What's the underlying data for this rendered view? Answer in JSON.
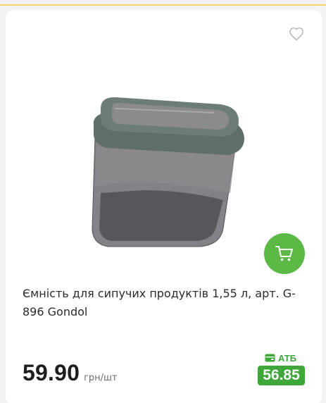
{
  "product": {
    "title": "Ємність для сипучих продуктів 1,55 л, арт. G-896 Gondol",
    "image_alt": "product-container-image"
  },
  "price": {
    "value": "59.90",
    "unit": "грн/шт"
  },
  "loyalty": {
    "label": "АТБ",
    "price": "56.85"
  },
  "icons": {
    "favorite": "heart-icon",
    "cart": "cart-icon",
    "loyalty": "wallet-icon"
  },
  "colors": {
    "accent_green": "#5cb946",
    "loyalty_green": "#3fa63a",
    "top_border": "#f2d56a"
  }
}
